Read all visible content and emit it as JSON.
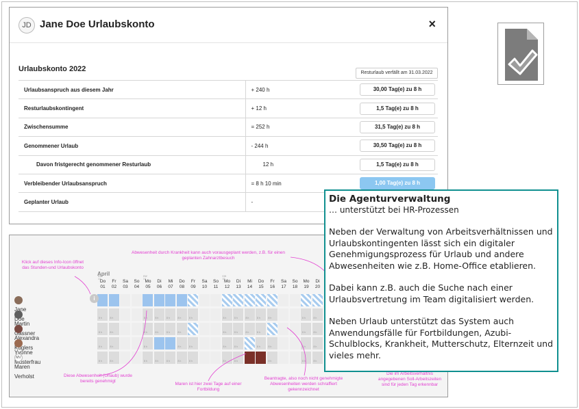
{
  "dialog": {
    "avatar_initials": "JD",
    "title": "Jane Doe Urlaubskonto",
    "close_glyph": "×",
    "konto_title": "Urlaubskonto 2022",
    "expiry_note": "Resturlaub verfällt am 31.03.2022",
    "rows": [
      {
        "label": "Urlaubsanspruch aus diesem Jahr",
        "amount": "+ 240 h",
        "days": "30,00 Tag(e) zu 8 h"
      },
      {
        "label": "Resturlaubskontingent",
        "amount": "+ 12 h",
        "days": "1,5 Tag(e) zu 8 h"
      },
      {
        "label": "Zwischensumme",
        "amount": "= 252 h",
        "days": "31,5 Tag(e) zu 8 h"
      },
      {
        "label": "Genommener Urlaub",
        "amount": "- 244 h",
        "days": "30,50 Tag(e) zu 8 h"
      },
      {
        "label": "Davon fristgerecht genommener Resturlaub",
        "amount": "12 h",
        "days": "1,5 Tag(e) zu 8 h"
      },
      {
        "label": "Verbleibender Urlaubsanspruch",
        "amount": "= 8 h 10 min",
        "days": "1,00 Tag(e) zu 8 h"
      },
      {
        "label": "Geplanter Urlaub",
        "amount": "-",
        "days": ""
      }
    ]
  },
  "calendar": {
    "month": "April",
    "info_glyph": "i",
    "hours_label": "8 h",
    "week_labels": [
      "KW 13",
      "KW 14",
      "KW 15"
    ],
    "days": [
      {
        "wd": "Do",
        "d": "01"
      },
      {
        "wd": "Fr",
        "d": "02"
      },
      {
        "wd": "Sa",
        "d": "03"
      },
      {
        "wd": "So",
        "d": "04"
      },
      {
        "wd": "Mo",
        "d": "05"
      },
      {
        "wd": "Di",
        "d": "06"
      },
      {
        "wd": "Mi",
        "d": "07"
      },
      {
        "wd": "Do",
        "d": "08"
      },
      {
        "wd": "Fr",
        "d": "09"
      },
      {
        "wd": "Sa",
        "d": "10"
      },
      {
        "wd": "So",
        "d": "11"
      },
      {
        "wd": "Mo",
        "d": "12"
      },
      {
        "wd": "Di",
        "d": "13"
      },
      {
        "wd": "Mi",
        "d": "14"
      },
      {
        "wd": "Do",
        "d": "15"
      },
      {
        "wd": "Fr",
        "d": "16"
      },
      {
        "wd": "Sa",
        "d": "17"
      },
      {
        "wd": "So",
        "d": "18"
      },
      {
        "wd": "Mo",
        "d": "19"
      },
      {
        "wd": "Di",
        "d": "20"
      }
    ],
    "people": [
      {
        "name": "Jane Doe",
        "initials": "",
        "color": "#8a6d5a"
      },
      {
        "name": "Martin Gassner",
        "initials": "",
        "color": "#5f5f5f"
      },
      {
        "name": "Alexandra Kuglers",
        "initials": "",
        "color": "#7a4a42"
      },
      {
        "name": "Yvonne Musterfrau",
        "initials": "",
        "color": "#9b6a50"
      },
      {
        "name": "Maren Verholst",
        "initials": "MV",
        "color": "#ffffff"
      }
    ],
    "annotations": {
      "info_icon": "Klick auf dieses Info-Icon öffnet das Stunden-und Urlaubskonto",
      "sick": "Abwesenheit durch Krankheit kann auch vorausgeplant werden, z.B. für einen geplanten Zahnarztbesuch",
      "approved": "Diese Abwesenheit (Urlaub) wurde bereits genehmigt",
      "training": "Maren ist hier zwei Tage auf einer Fortbildung",
      "requested": "Beantragte, also noch nicht genehmigte Abwesenheiten werden schraffiert gekennzeichnet",
      "target_hours": "Die im Arbeitsverhältnis angegebenen Soll-Arbeitszeiten sind für jeden Tag erkennbar"
    },
    "colors": {
      "approved": "#9cc4ee",
      "requested": "#a8ccef",
      "training": "#7a3028",
      "annotation": "#e23fd1"
    }
  },
  "agent_box": {
    "title": "Die Agenturverwaltung",
    "subtitle": "… unterstützt bei HR-Prozessen",
    "paragraphs": [
      "Neben der Verwaltung von Arbeitsverhältnissen und Urlaubskontingenten lässt sich ein digitaler Genehmigungsprozess für Urlaub und andere Abwesenheiten wie z.B. Home-Office etablieren.",
      "Dabei kann z.B. auch die Suche nach einer Urlaubsvertretung im Team digitalisiert werden.",
      "Neben Urlaub unterstützt das System auch Anwendungsfälle für Fortbildungen, Azubi-Schulblocks, Krankheit, Mutterschutz, Elternzeit und vieles mehr."
    ],
    "border_color": "#0f8f8f"
  },
  "file_icon": {
    "icon": "document-check-icon",
    "color": "#7c7c7c"
  }
}
